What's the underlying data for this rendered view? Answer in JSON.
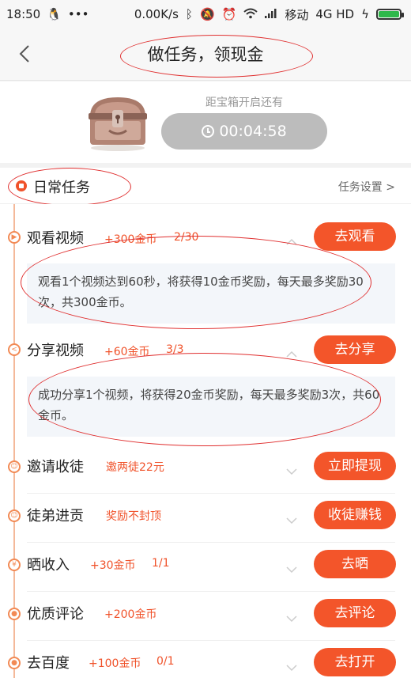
{
  "status_bar": {
    "time": "18:50",
    "speed": "0.00K/s",
    "carrier": "移动",
    "network": "4G HD"
  },
  "header": {
    "title": "做任务，领现金"
  },
  "chest": {
    "label": "距宝箱开启还有",
    "timer": "00:04:58"
  },
  "daily": {
    "title": "日常任务",
    "setting": "任务设置 >"
  },
  "tasks": [
    {
      "name": "观看视频",
      "reward": "+300金币",
      "progress": "2/30",
      "button": "去观看",
      "description": "观看1个视频达到60秒，将获得10金币奖励，每天最多奖励30次，共300金币。"
    },
    {
      "name": "分享视频",
      "reward": "+60金币",
      "progress": "3/3",
      "button": "去分享",
      "description": "成功分享1个视频，将获得20金币奖励，每天最多奖励3次，共60金币。"
    },
    {
      "name": "邀请收徒",
      "reward": "邀两徒22元",
      "progress": "",
      "button": "立即提现"
    },
    {
      "name": "徒弟进贡",
      "reward": "奖励不封顶",
      "progress": "",
      "button": "收徒赚钱"
    },
    {
      "name": "晒收入",
      "reward": "+30金币",
      "progress": "1/1",
      "button": "去晒"
    },
    {
      "name": "优质评论",
      "reward": "+200金币",
      "progress": "",
      "button": "去评论"
    },
    {
      "name": "去百度",
      "reward": "+100金币",
      "progress": "0/1",
      "button": "去打开"
    }
  ],
  "colors": {
    "accent": "#f3552a",
    "timer_bg": "#bcbcbc",
    "desc_bg": "#f3f6fa",
    "annotation": "#e03030"
  }
}
